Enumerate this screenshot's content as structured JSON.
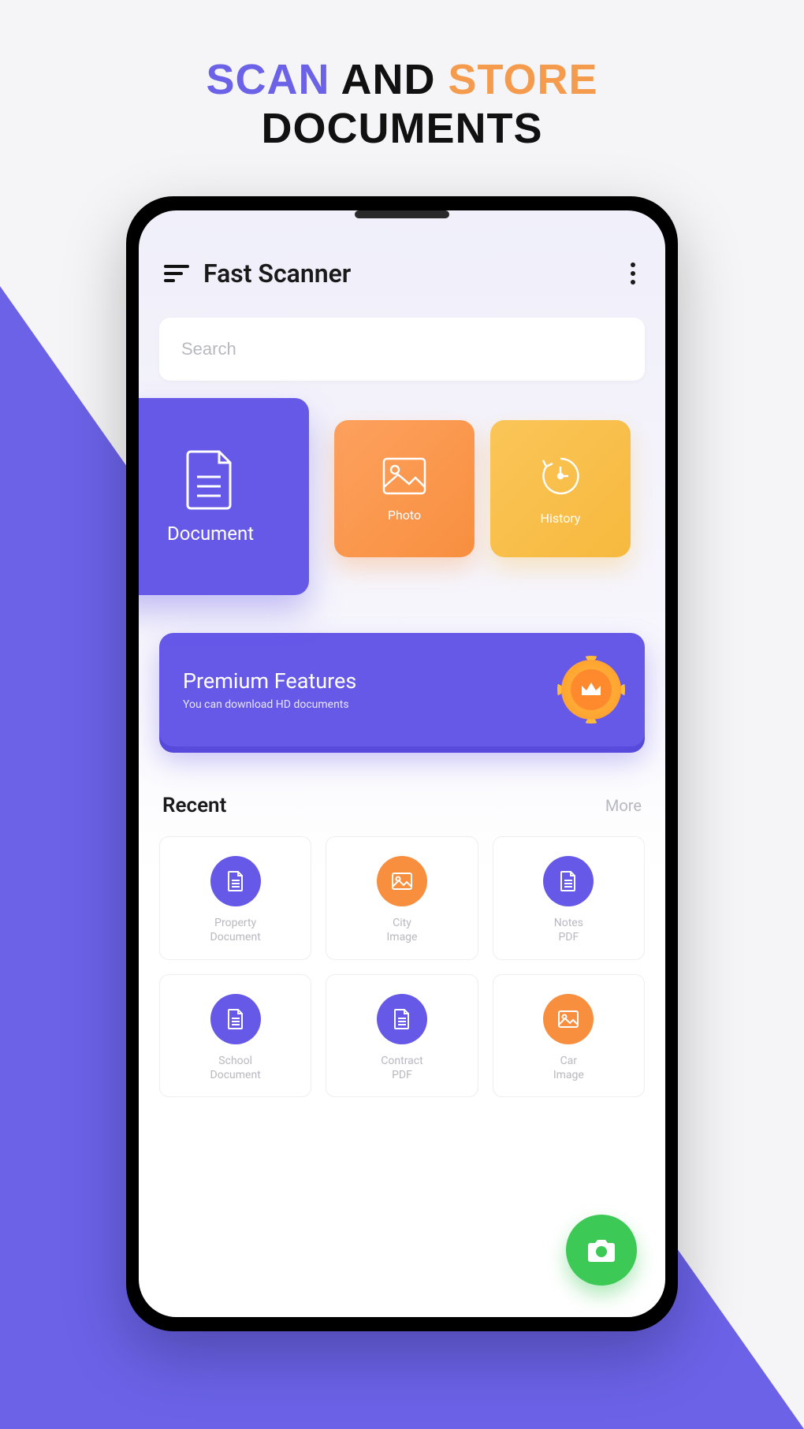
{
  "headline": {
    "w1": "SCAN",
    "w2": "AND",
    "w3": "STORE",
    "w4": "DOCUMENTS"
  },
  "header": {
    "title": "Fast Scanner"
  },
  "search": {
    "placeholder": "Search"
  },
  "categories": {
    "document": "Document",
    "photo": "Photo",
    "history": "History"
  },
  "premium": {
    "title": "Premium Features",
    "subtitle": "You can download HD documents"
  },
  "recent": {
    "title": "Recent",
    "more": "More",
    "items": [
      {
        "label": "Property\nDocument",
        "icon": "document",
        "color": "purple"
      },
      {
        "label": "City\nImage",
        "icon": "image",
        "color": "orange"
      },
      {
        "label": "Notes\nPDF",
        "icon": "document",
        "color": "purple"
      },
      {
        "label": "School\nDocument",
        "icon": "document",
        "color": "purple"
      },
      {
        "label": "Contract\nPDF",
        "icon": "document",
        "color": "purple"
      },
      {
        "label": "Car\nImage",
        "icon": "image",
        "color": "orange"
      }
    ]
  },
  "colors": {
    "primary": "#6659e8",
    "orange": "#f88f3f",
    "yellow": "#f7b93e",
    "green": "#3cc956"
  }
}
